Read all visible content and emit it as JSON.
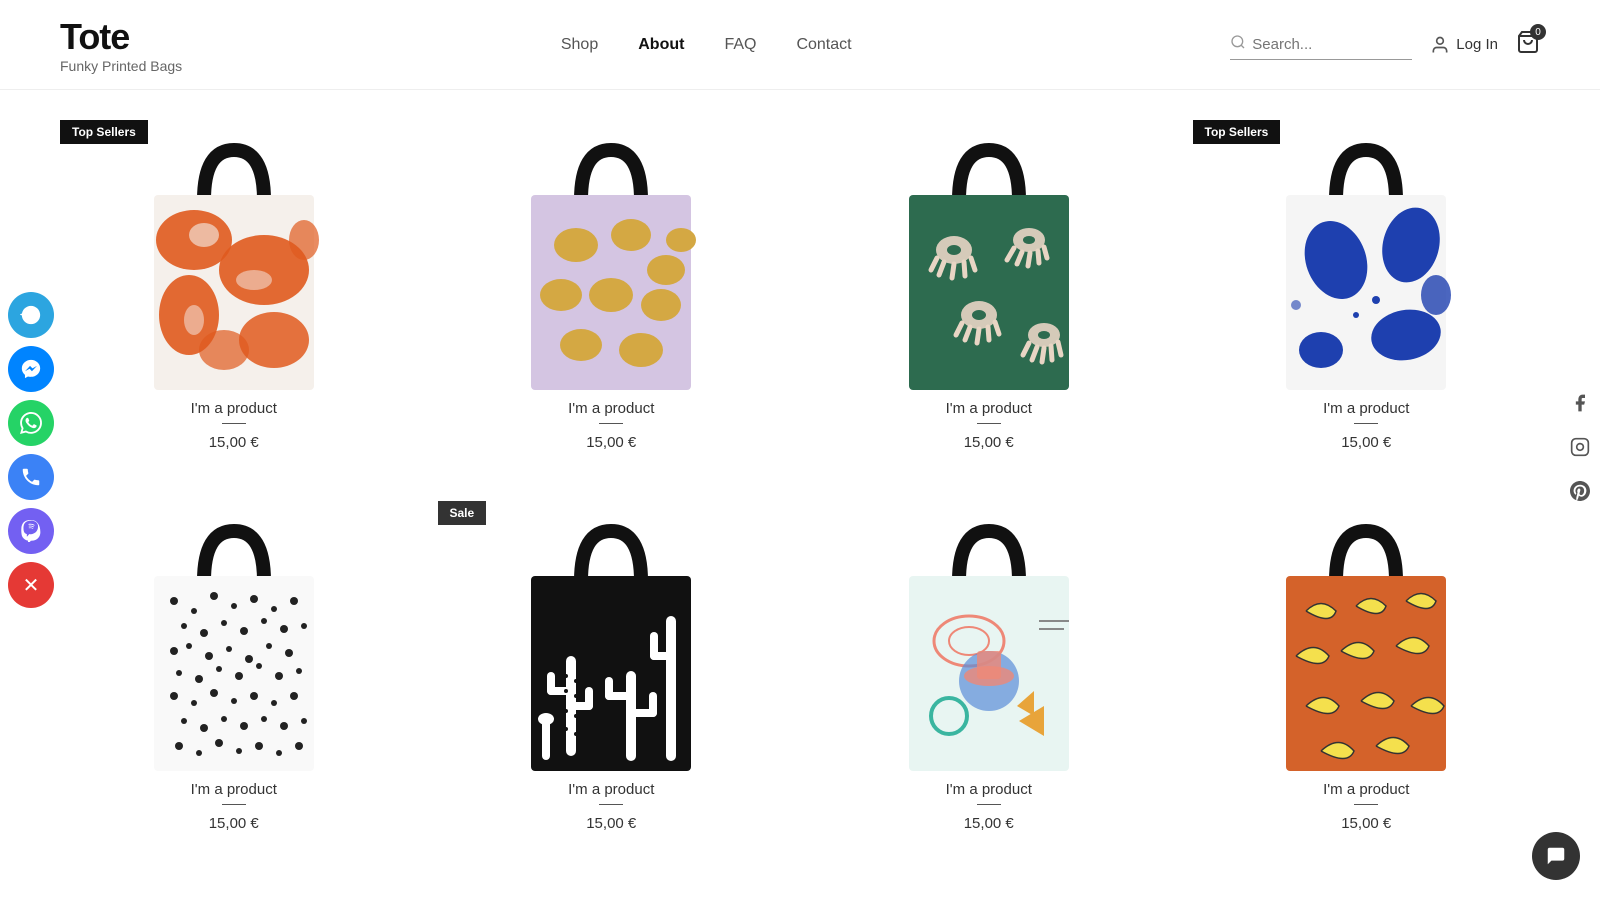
{
  "brand": {
    "title": "Tote",
    "subtitle": "Funky Printed Bags"
  },
  "nav": {
    "items": [
      {
        "label": "Shop",
        "active": false
      },
      {
        "label": "About",
        "active": true
      },
      {
        "label": "FAQ",
        "active": false
      },
      {
        "label": "Contact",
        "active": false
      }
    ]
  },
  "header": {
    "search_placeholder": "Search...",
    "login_label": "Log In",
    "cart_count": "0"
  },
  "products_row1": [
    {
      "name": "I'm a product",
      "price": "15,00 €",
      "badge": "Top Sellers",
      "bag_style": "orange",
      "id": "p1"
    },
    {
      "name": "I'm a product",
      "price": "15,00 €",
      "badge": null,
      "bag_style": "lemon",
      "id": "p2"
    },
    {
      "name": "I'm a product",
      "price": "15,00 €",
      "badge": null,
      "bag_style": "eyes",
      "id": "p3"
    },
    {
      "name": "I'm a product",
      "price": "15,00 €",
      "badge": "Top Sellers",
      "bag_style": "blue",
      "id": "p4"
    }
  ],
  "products_row2": [
    {
      "name": "I'm a product",
      "price": "15,00 €",
      "badge": null,
      "bag_style": "dots",
      "id": "p5"
    },
    {
      "name": "I'm a product",
      "price": "15,00 €",
      "badge": "Sale",
      "bag_style": "cactus",
      "id": "p6"
    },
    {
      "name": "I'm a product",
      "price": "15,00 €",
      "badge": null,
      "bag_style": "abstract",
      "id": "p7"
    },
    {
      "name": "I'm a product",
      "price": "15,00 €",
      "badge": null,
      "bag_style": "banana",
      "id": "p8"
    }
  ],
  "social": {
    "telegram": "✈",
    "messenger": "m",
    "whatsapp": "✓",
    "phone": "☎",
    "viber": "V",
    "close": "✕"
  },
  "right_social": {
    "facebook": "f",
    "instagram": "◎",
    "pinterest": "P"
  }
}
